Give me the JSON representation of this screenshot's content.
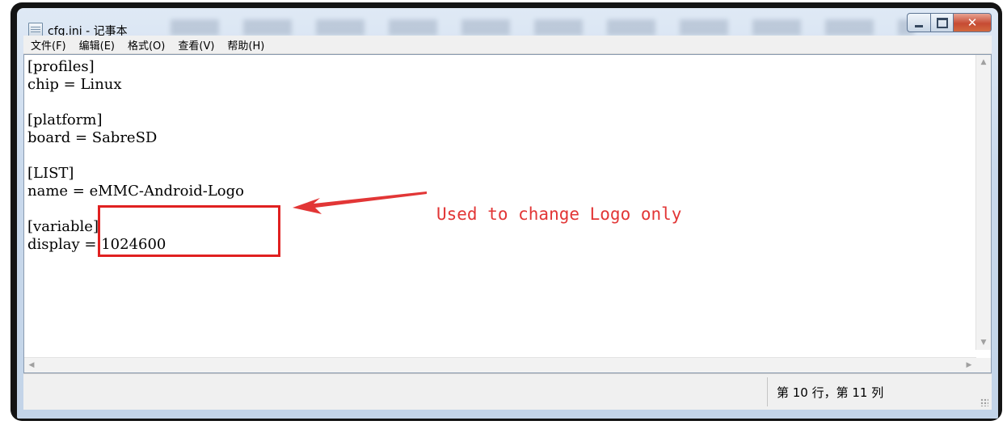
{
  "window": {
    "title": "cfg.ini - 记事本"
  },
  "caption_buttons": [
    "minimize",
    "maximize",
    "close"
  ],
  "menu": {
    "items": [
      "文件(F)",
      "编辑(E)",
      "格式(O)",
      "查看(V)",
      "帮助(H)"
    ]
  },
  "editor": {
    "lines": [
      "[profiles]",
      "chip = Linux",
      "",
      "[platform]",
      "board = SabreSD",
      "",
      "[LIST]",
      "name = eMMC-Android-Logo",
      "",
      "[variable]",
      "display = 1024600"
    ]
  },
  "annotation": {
    "text": "Used to change Logo only",
    "color": "#e23636"
  },
  "status": {
    "position": "第 10 行，第 11 列"
  }
}
